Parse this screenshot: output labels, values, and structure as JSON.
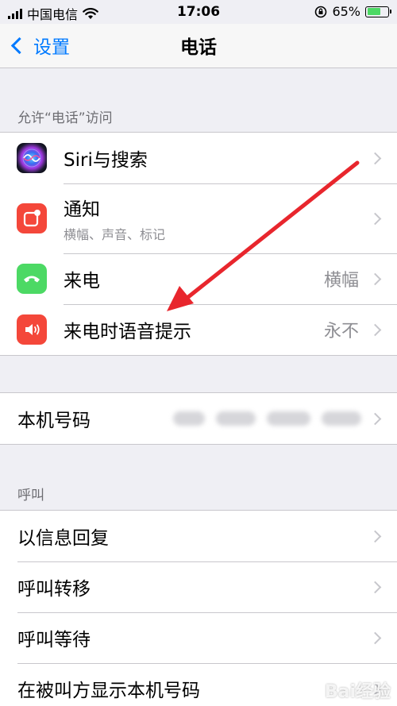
{
  "status_bar": {
    "carrier": "中国电信",
    "time": "17:06",
    "battery_text": "65%",
    "battery_level": 0.65
  },
  "nav": {
    "back_label": "设置",
    "title": "电话"
  },
  "section_allow": {
    "header": "允许“电话”访问"
  },
  "allow_items": [
    {
      "label": "Siri与搜索",
      "icon": "siri-icon"
    },
    {
      "label": "通知",
      "subtitle": "横幅、声音、标记",
      "icon": "notification-icon"
    },
    {
      "label": "来电",
      "value": "横幅",
      "icon": "incoming-call-icon"
    },
    {
      "label": "来电时语音提示",
      "value": "永不",
      "icon": "speaker-icon"
    }
  ],
  "my_number": {
    "label": "本机号码"
  },
  "section_calling": {
    "header": "呼叫"
  },
  "calling_items": [
    {
      "label": "以信息回复"
    },
    {
      "label": "呼叫转移"
    },
    {
      "label": "呼叫等待"
    },
    {
      "label": "在被叫方显示本机号码"
    }
  ],
  "colors": {
    "accent": "#007aff",
    "notification_icon": "#f4473a",
    "incoming_call_icon": "#4cd964",
    "speaker_icon": "#f4473a",
    "annotation_arrow": "#e8262d"
  },
  "watermark": {
    "text": "Bai经验"
  }
}
